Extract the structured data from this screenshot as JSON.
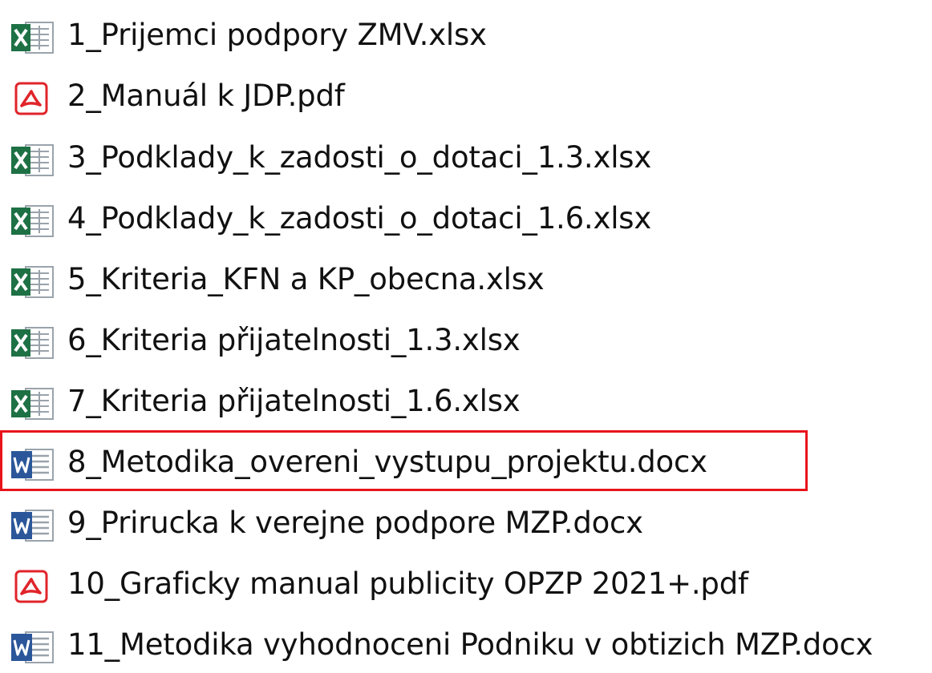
{
  "explorer": {
    "files": [
      {
        "name": "1_Prijemci podpory ZMV.xlsx",
        "type": "excel",
        "icon": "excel-file-icon"
      },
      {
        "name": "2_Manuál k JDP.pdf",
        "type": "pdf",
        "icon": "pdf-file-icon"
      },
      {
        "name": "3_Podklady_k_zadosti_o_dotaci_1.3.xlsx",
        "type": "excel",
        "icon": "excel-file-icon"
      },
      {
        "name": "4_Podklady_k_zadosti_o_dotaci_1.6.xlsx",
        "type": "excel",
        "icon": "excel-file-icon"
      },
      {
        "name": "5_Kriteria_KFN a KP_obecna.xlsx",
        "type": "excel",
        "icon": "excel-file-icon"
      },
      {
        "name": "6_Kriteria přijatelnosti_1.3.xlsx",
        "type": "excel",
        "icon": "excel-file-icon"
      },
      {
        "name": "7_Kriteria přijatelnosti_1.6.xlsx",
        "type": "excel",
        "icon": "excel-file-icon"
      },
      {
        "name": "8_Metodika_overeni_vystupu_projektu.docx",
        "type": "word",
        "icon": "word-file-icon"
      },
      {
        "name": "9_Prirucka k verejne podpore MZP.docx",
        "type": "word",
        "icon": "word-file-icon"
      },
      {
        "name": "10_Graficky manual publicity OPZP 2021+.pdf",
        "type": "pdf",
        "icon": "pdf-file-icon"
      },
      {
        "name": "11_Metodika vyhodnoceni Podniku v obtizich MZP.docx",
        "type": "word",
        "icon": "word-file-icon"
      }
    ],
    "highlighted_file_index": 7,
    "colors": {
      "highlight_border": "#e8141b",
      "excel_green": "#1e7145",
      "word_blue": "#2b579a",
      "pdf_red": "#e0242a"
    }
  }
}
